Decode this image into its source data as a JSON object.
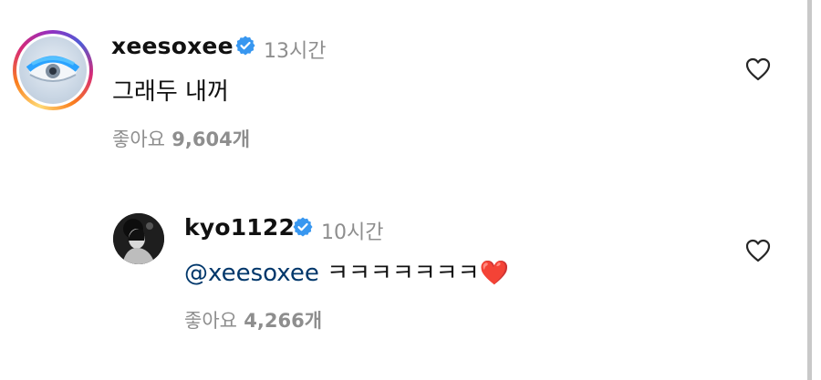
{
  "comments": [
    {
      "username": "xeesoxee",
      "time": "13시간",
      "text": "그래두 내꺼",
      "likes_label": "좋아요",
      "likes_count": "9,604개"
    },
    {
      "username": "kyo1122",
      "time": "10시간",
      "mention": "@xeesoxee",
      "text": "ㅋㅋㅋㅋㅋㅋㅋ",
      "emoji": "❤️",
      "likes_label": "좋아요",
      "likes_count": "4,266개"
    }
  ],
  "icons": {
    "verified": "verified-badge-icon",
    "like": "heart-outline-icon"
  },
  "colors": {
    "verified": "#3897f0",
    "secondary_text": "#8e8e8e",
    "mention": "#00376b"
  }
}
